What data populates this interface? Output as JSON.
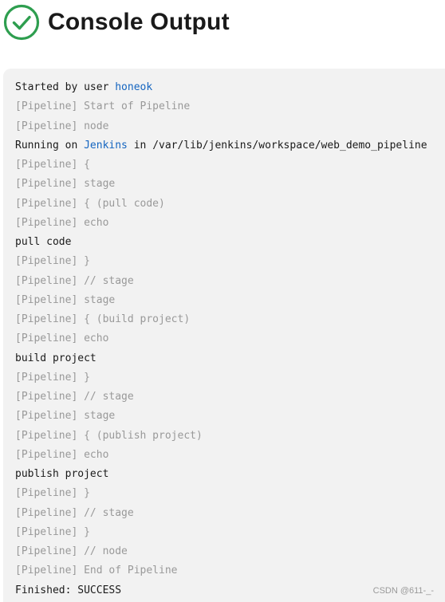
{
  "header": {
    "title": "Console Output",
    "status_icon": "success-check-circle-icon",
    "status_color": "#2e9e4f"
  },
  "console": {
    "background": "#f2f2f2",
    "link_color": "#1565c0",
    "muted_color": "#999999",
    "started_prefix": "Started by user ",
    "started_user": "honeok",
    "running_prefix": "Running on ",
    "running_node": "Jenkins",
    "running_suffix": " in /var/lib/jenkins/workspace/web_demo_pipeline",
    "lines": [
      "[Pipeline] Start of Pipeline",
      "[Pipeline] node",
      "[Pipeline] {",
      "[Pipeline] stage",
      "[Pipeline] { (pull code)",
      "[Pipeline] echo",
      "pull code",
      "[Pipeline] }",
      "[Pipeline] // stage",
      "[Pipeline] stage",
      "[Pipeline] { (build project)",
      "[Pipeline] echo",
      "build project",
      "[Pipeline] }",
      "[Pipeline] // stage",
      "[Pipeline] stage",
      "[Pipeline] { (publish project)",
      "[Pipeline] echo",
      "publish project",
      "[Pipeline] }",
      "[Pipeline] // stage",
      "[Pipeline] }",
      "[Pipeline] // node",
      "[Pipeline] End of Pipeline",
      "Finished: SUCCESS"
    ]
  },
  "watermark": "CSDN @611-_-"
}
